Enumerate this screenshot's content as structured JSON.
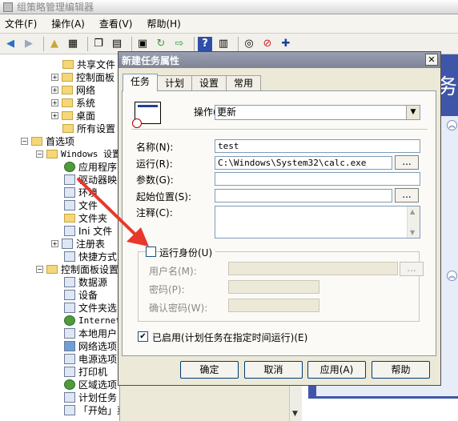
{
  "app": {
    "title": "组策略管理编辑器"
  },
  "menu": [
    "文件(F)",
    "操作(A)",
    "查看(V)",
    "帮助(H)"
  ],
  "toolbar_icons": [
    "back-icon",
    "forward-icon",
    "up-folder-icon",
    "show-hide-tree-icon",
    "copy-icon",
    "paste-icon",
    "print-icon",
    "refresh-icon",
    "export-icon",
    "help-icon",
    "properties-icon",
    "delete-icon",
    "add-icon"
  ],
  "tree": {
    "items": [
      {
        "label": "共享文件",
        "expand": ""
      },
      {
        "label": "控制面板",
        "expand": "+"
      },
      {
        "label": "网络",
        "expand": "+"
      },
      {
        "label": "系统",
        "expand": "+"
      },
      {
        "label": "桌面",
        "expand": "+"
      },
      {
        "label": "所有设置",
        "expand": ""
      },
      {
        "label": "首选项",
        "expand": "−"
      },
      {
        "label": "Windows 设置",
        "expand": "−"
      },
      {
        "label": "应用程序",
        "expand": ""
      },
      {
        "label": "驱动器映",
        "expand": ""
      },
      {
        "label": "环境",
        "expand": ""
      },
      {
        "label": "文件",
        "expand": ""
      },
      {
        "label": "文件夹",
        "expand": ""
      },
      {
        "label": "Ini 文件",
        "expand": ""
      },
      {
        "label": "注册表",
        "expand": "+"
      },
      {
        "label": "快捷方式",
        "expand": ""
      },
      {
        "label": "控制面板设置",
        "expand": "−"
      },
      {
        "label": "数据源",
        "expand": ""
      },
      {
        "label": "设备",
        "expand": ""
      },
      {
        "label": "文件夹选",
        "expand": ""
      },
      {
        "label": "Internet",
        "expand": ""
      },
      {
        "label": "本地用户",
        "expand": ""
      },
      {
        "label": "网络选项",
        "expand": ""
      },
      {
        "label": "电源选项",
        "expand": ""
      },
      {
        "label": "打印机",
        "expand": ""
      },
      {
        "label": "区域选项",
        "expand": ""
      },
      {
        "label": "计划任务",
        "expand": ""
      },
      {
        "label": "「开始」菜单",
        "expand": ""
      }
    ]
  },
  "right_pane": {
    "banner_text": "务"
  },
  "dialog": {
    "title": "新建任务属性",
    "close_label": "✕",
    "tabs": [
      "任务",
      "计划",
      "设置",
      "常用"
    ],
    "action_label": "操作(T):",
    "action_value": "更新",
    "name_label": "名称(N):",
    "name_value": "test",
    "run_label": "运行(R):",
    "run_value": "C:\\Windows\\System32\\calc.exe",
    "args_label": "参数(G):",
    "args_value": "",
    "startin_label": "起始位置(S):",
    "startin_value": "",
    "comment_label": "注释(C):",
    "browse_label": "...",
    "runas": {
      "checkbox_label": "运行身份(U)",
      "checked": false,
      "username_label": "用户名(M):",
      "password_label": "密码(P):",
      "confirm_label": "确认密码(W):"
    },
    "enabled_label": "已启用(计划任务在指定时间运行)(E)",
    "enabled_checked": true,
    "buttons": {
      "ok": "确定",
      "cancel": "取消",
      "apply": "应用(A)",
      "help": "帮助"
    }
  },
  "colors": {
    "dialog_bg": "#ece9d8",
    "title_bar": "#7e8496",
    "annotation_arrow": "#e8382b",
    "banner": "#3f56a8"
  }
}
